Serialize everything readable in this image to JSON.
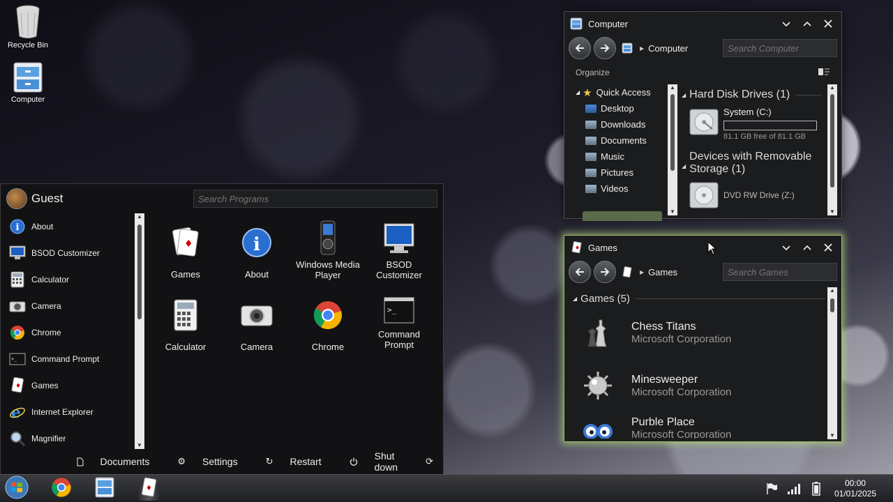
{
  "desktop": {
    "icons": [
      {
        "label": "Recycle Bin",
        "icon": "recycle-bin-icon"
      },
      {
        "label": "Computer",
        "icon": "computer-icon"
      }
    ]
  },
  "computer_window": {
    "title": "Computer",
    "breadcrumb": "Computer",
    "search_placeholder": "Search Computer",
    "organize": "Organize",
    "nav": [
      {
        "label": "Quick Access",
        "icon": "star-icon"
      },
      {
        "label": "Desktop",
        "icon": "desktop-folder-icon"
      },
      {
        "label": "Downloads",
        "icon": "folder-icon"
      },
      {
        "label": "Documents",
        "icon": "folder-icon"
      },
      {
        "label": "Music",
        "icon": "folder-icon"
      },
      {
        "label": "Pictures",
        "icon": "folder-icon"
      },
      {
        "label": "Videos",
        "icon": "folder-icon"
      }
    ],
    "sections": {
      "hdd": "Hard Disk Drives (1)",
      "removable": "Devices with Removable Storage (1)"
    },
    "drives": {
      "system_name": "System (C:)",
      "system_free": "81.1 GB free of 81.1 GB",
      "system_used_fraction": 0.0,
      "dvd_name": "DVD RW Drive (Z:)"
    }
  },
  "games_window": {
    "title": "Games",
    "breadcrumb": "Games",
    "search_placeholder": "Search Games",
    "section": "Games (5)",
    "games": [
      {
        "name": "Chess Titans",
        "publisher": "Microsoft Corporation",
        "icon": "chess-icon"
      },
      {
        "name": "Minesweeper",
        "publisher": "Microsoft Corporation",
        "icon": "mine-icon"
      },
      {
        "name": "Purble Place",
        "publisher": "Microsoft Corporation",
        "icon": "purble-icon"
      }
    ]
  },
  "start_menu": {
    "user": "Guest",
    "search_placeholder": "Search Programs",
    "programs": [
      {
        "label": "About",
        "icon": "info-icon"
      },
      {
        "label": "BSOD Customizer",
        "icon": "monitor-icon"
      },
      {
        "label": "Calculator",
        "icon": "calculator-icon"
      },
      {
        "label": "Camera",
        "icon": "camera-icon"
      },
      {
        "label": "Chrome",
        "icon": "chrome-icon"
      },
      {
        "label": "Command Prompt",
        "icon": "terminal-icon"
      },
      {
        "label": "Games",
        "icon": "cards-icon"
      },
      {
        "label": "Internet Explorer",
        "icon": "ie-icon"
      },
      {
        "label": "Magnifier",
        "icon": "magnifier-icon"
      }
    ],
    "tiles": [
      {
        "label": "Games",
        "icon": "cards-icon"
      },
      {
        "label": "About",
        "icon": "info-icon"
      },
      {
        "label": "Windows Media Player",
        "icon": "media-player-icon"
      },
      {
        "label": "BSOD Customizer",
        "icon": "monitor-icon"
      },
      {
        "label": "Calculator",
        "icon": "calculator-icon"
      },
      {
        "label": "Camera",
        "icon": "camera-icon"
      },
      {
        "label": "Chrome",
        "icon": "chrome-icon"
      },
      {
        "label": "Command Prompt",
        "icon": "terminal-icon"
      }
    ],
    "footer": {
      "documents": "Documents",
      "settings": "Settings",
      "restart": "Restart",
      "shutdown": "Shut down"
    }
  },
  "taskbar": {
    "time": "00:00",
    "date": "01/01/2025"
  },
  "colors": {
    "active_glow": "#b4dc78",
    "window_bg": "#1b1c1e"
  }
}
